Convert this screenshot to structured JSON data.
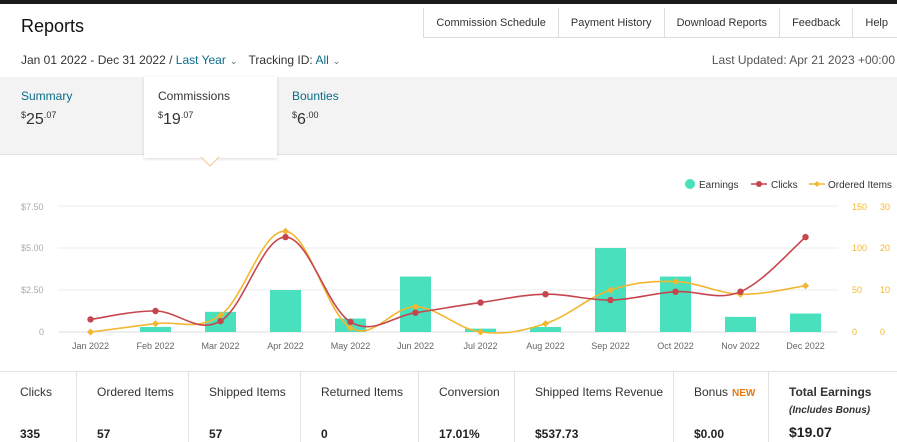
{
  "header": {
    "title": "Reports",
    "nav": [
      "Commission Schedule",
      "Payment History",
      "Download Reports",
      "Feedback",
      "Help"
    ]
  },
  "filters": {
    "date_range": "Jan 01 2022 - Dec 31 2022 /",
    "period": "Last Year",
    "tracking_label": "Tracking ID:",
    "tracking_value": "All",
    "last_updated": "Last Updated: Apr 21 2023 +00:00"
  },
  "tabs": {
    "summary": {
      "label": "Summary",
      "dollars": "25",
      "cents": "07"
    },
    "commissions": {
      "label": "Commissions",
      "dollars": "19",
      "cents": "07"
    },
    "bounties": {
      "label": "Bounties",
      "dollars": "6",
      "cents": "00"
    }
  },
  "colors": {
    "earnings": "#48e0bd",
    "clicks": "#c6464e",
    "ordered": "#f2b730",
    "link": "#0a6c8a",
    "new_badge": "#e47911"
  },
  "chart_data": {
    "type": "bar",
    "categories": [
      "Jan 2022",
      "Feb 2022",
      "Mar 2022",
      "Apr 2022",
      "May 2022",
      "Jun 2022",
      "Jul 2022",
      "Aug 2022",
      "Sep 2022",
      "Oct 2022",
      "Nov 2022",
      "Dec 2022"
    ],
    "legend": [
      "Earnings",
      "Clicks",
      "Ordered Items"
    ],
    "left_ticks": [
      "$7.50",
      "$5.00",
      "$2.50",
      "0"
    ],
    "right_ticks_clicks": [
      "150",
      "100",
      "50",
      "0"
    ],
    "right_ticks_items": [
      "30",
      "20",
      "10",
      "0"
    ],
    "ylim_earnings": [
      0,
      7.5
    ],
    "ylim_clicks": [
      0,
      150
    ],
    "ylim_items": [
      0,
      30
    ],
    "series": [
      {
        "name": "Earnings",
        "type": "bar",
        "values": [
          0,
          0.3,
          1.2,
          2.5,
          0.8,
          3.3,
          0.2,
          0.3,
          5.0,
          3.3,
          0.9,
          1.1
        ]
      },
      {
        "name": "Clicks",
        "type": "line",
        "values": [
          15,
          25,
          13,
          113,
          12,
          23,
          35,
          45,
          38,
          48,
          48,
          113
        ]
      },
      {
        "name": "Ordered Items",
        "type": "line",
        "values": [
          0,
          2,
          4,
          24,
          1,
          6,
          0,
          2,
          10,
          12,
          9,
          11
        ]
      }
    ]
  },
  "stats": [
    {
      "label": "Clicks",
      "value": "335"
    },
    {
      "label": "Ordered Items",
      "value": "57"
    },
    {
      "label": "Shipped Items",
      "value": "57"
    },
    {
      "label": "Returned Items",
      "value": "0"
    },
    {
      "label": "Conversion",
      "value": "17.01%"
    },
    {
      "label": "Shipped Items Revenue",
      "value": "$537.73"
    },
    {
      "label": "Bonus",
      "badge": "NEW",
      "value": "$0.00"
    },
    {
      "label": "Total Earnings",
      "sub": "(Includes Bonus)",
      "value": "$19.07"
    }
  ]
}
